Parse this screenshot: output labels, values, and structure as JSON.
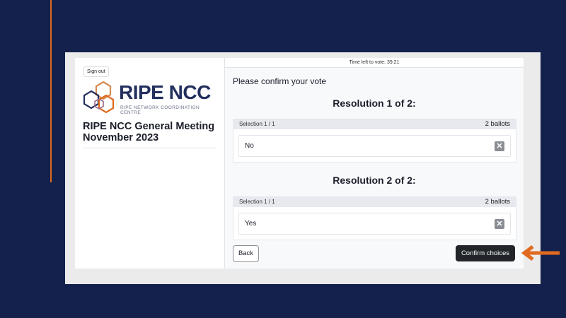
{
  "sidebar": {
    "signout_label": "Sign out",
    "logo_text": "RIPE NCC",
    "logo_subtitle": "RIPE NETWORK COORDINATION CENTRE",
    "meeting_title": "RIPE NCC General Meeting November 2023"
  },
  "header": {
    "timer_text": "Time left to vote: 39:21"
  },
  "main": {
    "prompt": "Please confirm your vote",
    "resolutions": [
      {
        "title": "Resolution 1 of 2:",
        "selection": "Selection 1 / 1",
        "ballots": "2 ballots",
        "choice": "No"
      },
      {
        "title": "Resolution 2 of 2:",
        "selection": "Selection 1 / 1",
        "ballots": "2 ballots",
        "choice": "Yes"
      }
    ]
  },
  "footer": {
    "back_label": "Back",
    "confirm_label": "Confirm choices"
  },
  "colors": {
    "background": "#14214c",
    "accent": "#e06a1f",
    "logo_blue": "#23305e",
    "button_dark": "#212529"
  },
  "icons": {
    "remove": "x-icon",
    "arrow": "arrow-left-icon"
  }
}
